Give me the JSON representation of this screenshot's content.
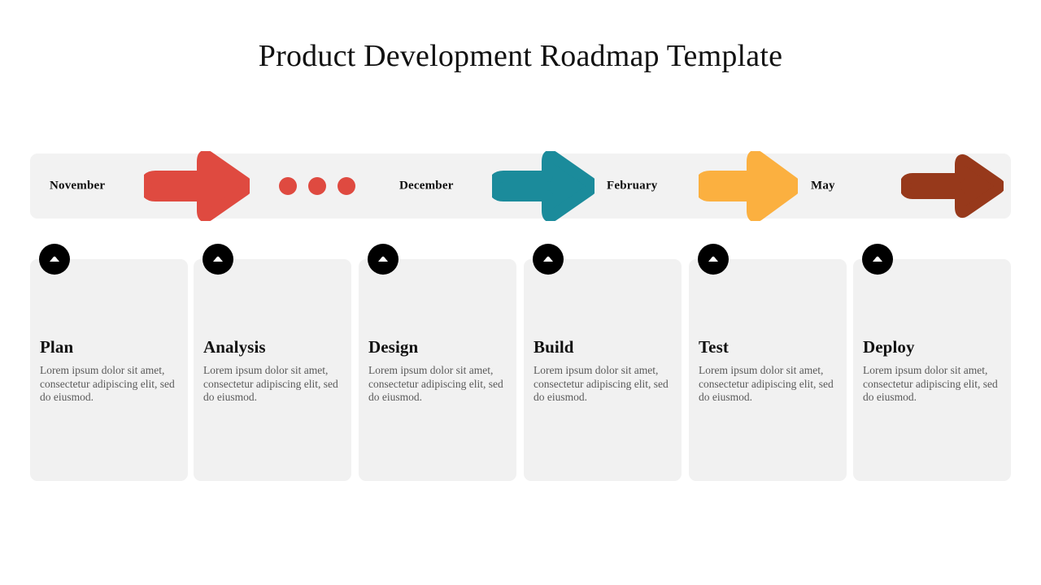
{
  "title": "Product Development Roadmap Template",
  "colors": {
    "red": "#DF4A40",
    "teal": "#1B8B9B",
    "orange": "#FBB040",
    "brown": "#97391B",
    "bar_background": "#F2F2F2",
    "card_background": "#F1F1F1",
    "badge": "#000000",
    "heading_text": "#111111",
    "body_text": "#5A5A5A",
    "page_background": "#FFFFFF"
  },
  "timeline": {
    "labels": [
      {
        "text": "November"
      },
      {
        "text": "December"
      },
      {
        "text": "February"
      },
      {
        "text": "May"
      }
    ],
    "arrows": [
      {
        "name": "arrow-red",
        "color": "#DF4A40"
      },
      {
        "name": "arrow-teal",
        "color": "#1B8B9B"
      },
      {
        "name": "arrow-orange",
        "color": "#FBB040"
      },
      {
        "name": "arrow-brown",
        "color": "#97391B"
      }
    ],
    "dots": [
      {
        "color": "#DF4A40"
      },
      {
        "color": "#DF4A40"
      },
      {
        "color": "#DF4A40"
      }
    ]
  },
  "cards": [
    {
      "heading": "Plan",
      "text": "Lorem ipsum dolor sit amet, consectetur adipiscing elit, sed do eiusmod.",
      "icon": "chevron-up-icon"
    },
    {
      "heading": "Analysis",
      "text": "Lorem ipsum dolor sit amet, consectetur adipiscing elit, sed do eiusmod.",
      "icon": "chevron-up-icon"
    },
    {
      "heading": "Design",
      "text": "Lorem ipsum dolor sit amet, consectetur adipiscing elit, sed do eiusmod.",
      "icon": "chevron-up-icon"
    },
    {
      "heading": "Build",
      "text": "Lorem ipsum dolor sit amet, consectetur adipiscing elit, sed do eiusmod.",
      "icon": "chevron-up-icon"
    },
    {
      "heading": "Test",
      "text": "Lorem ipsum dolor sit amet, consectetur adipiscing elit, sed do eiusmod.",
      "icon": "chevron-up-icon"
    },
    {
      "heading": "Deploy",
      "text": "Lorem ipsum dolor sit amet, consectetur adipiscing elit, sed do eiusmod.",
      "icon": "chevron-up-icon"
    }
  ]
}
